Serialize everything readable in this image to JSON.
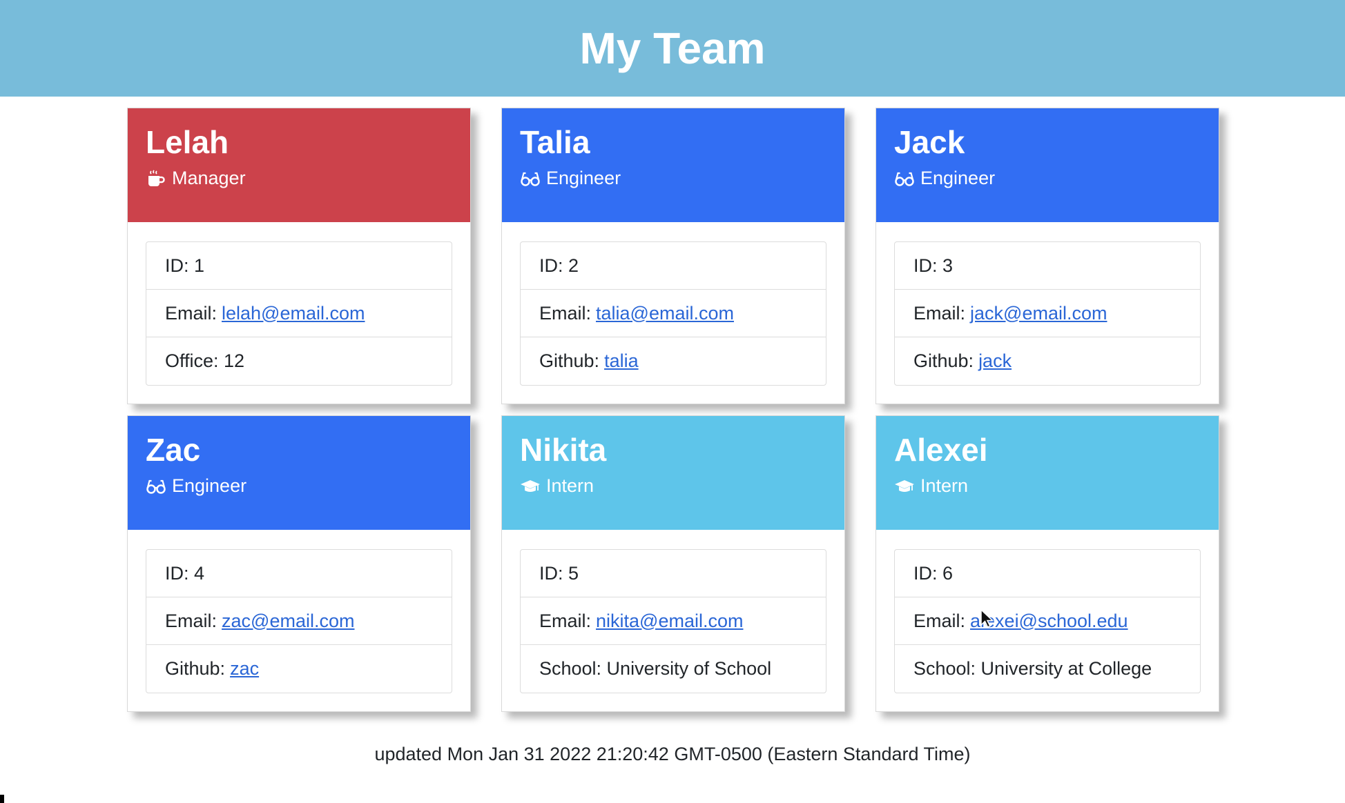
{
  "header": {
    "title": "My Team"
  },
  "colors": {
    "header": "#78bcda",
    "manager": "#cc424b",
    "engineer": "#326ef3",
    "intern": "#5ec5ea",
    "link": "#2a66d6"
  },
  "members": [
    {
      "name": "Lelah",
      "role": "Manager",
      "role_icon": "coffee-mug-icon",
      "id_label": "ID: 1",
      "email_label": "Email:",
      "email": "lelah@email.com",
      "extra_label": "Office: 12",
      "extra_link": ""
    },
    {
      "name": "Talia",
      "role": "Engineer",
      "role_icon": "glasses-icon",
      "id_label": "ID: 2",
      "email_label": "Email:",
      "email": "talia@email.com",
      "extra_label": "Github:",
      "extra_link": "talia"
    },
    {
      "name": "Jack",
      "role": "Engineer",
      "role_icon": "glasses-icon",
      "id_label": "ID: 3",
      "email_label": "Email:",
      "email": "jack@email.com",
      "extra_label": "Github:",
      "extra_link": "jack"
    },
    {
      "name": "Zac",
      "role": "Engineer",
      "role_icon": "glasses-icon",
      "id_label": "ID: 4",
      "email_label": "Email:",
      "email": "zac@email.com",
      "extra_label": "Github:",
      "extra_link": "zac"
    },
    {
      "name": "Nikita",
      "role": "Intern",
      "role_icon": "graduation-cap-icon",
      "id_label": "ID: 5",
      "email_label": "Email:",
      "email": "nikita@email.com",
      "extra_label": "School: University of School",
      "extra_link": ""
    },
    {
      "name": "Alexei",
      "role": "Intern",
      "role_icon": "graduation-cap-icon",
      "id_label": "ID: 6",
      "email_label": "Email:",
      "email": "alexei@school.edu",
      "extra_label": "School: University at College",
      "extra_link": ""
    }
  ],
  "footer": {
    "updated": "updated Mon Jan 31 2022 21:20:42 GMT-0500 (Eastern Standard Time)"
  }
}
